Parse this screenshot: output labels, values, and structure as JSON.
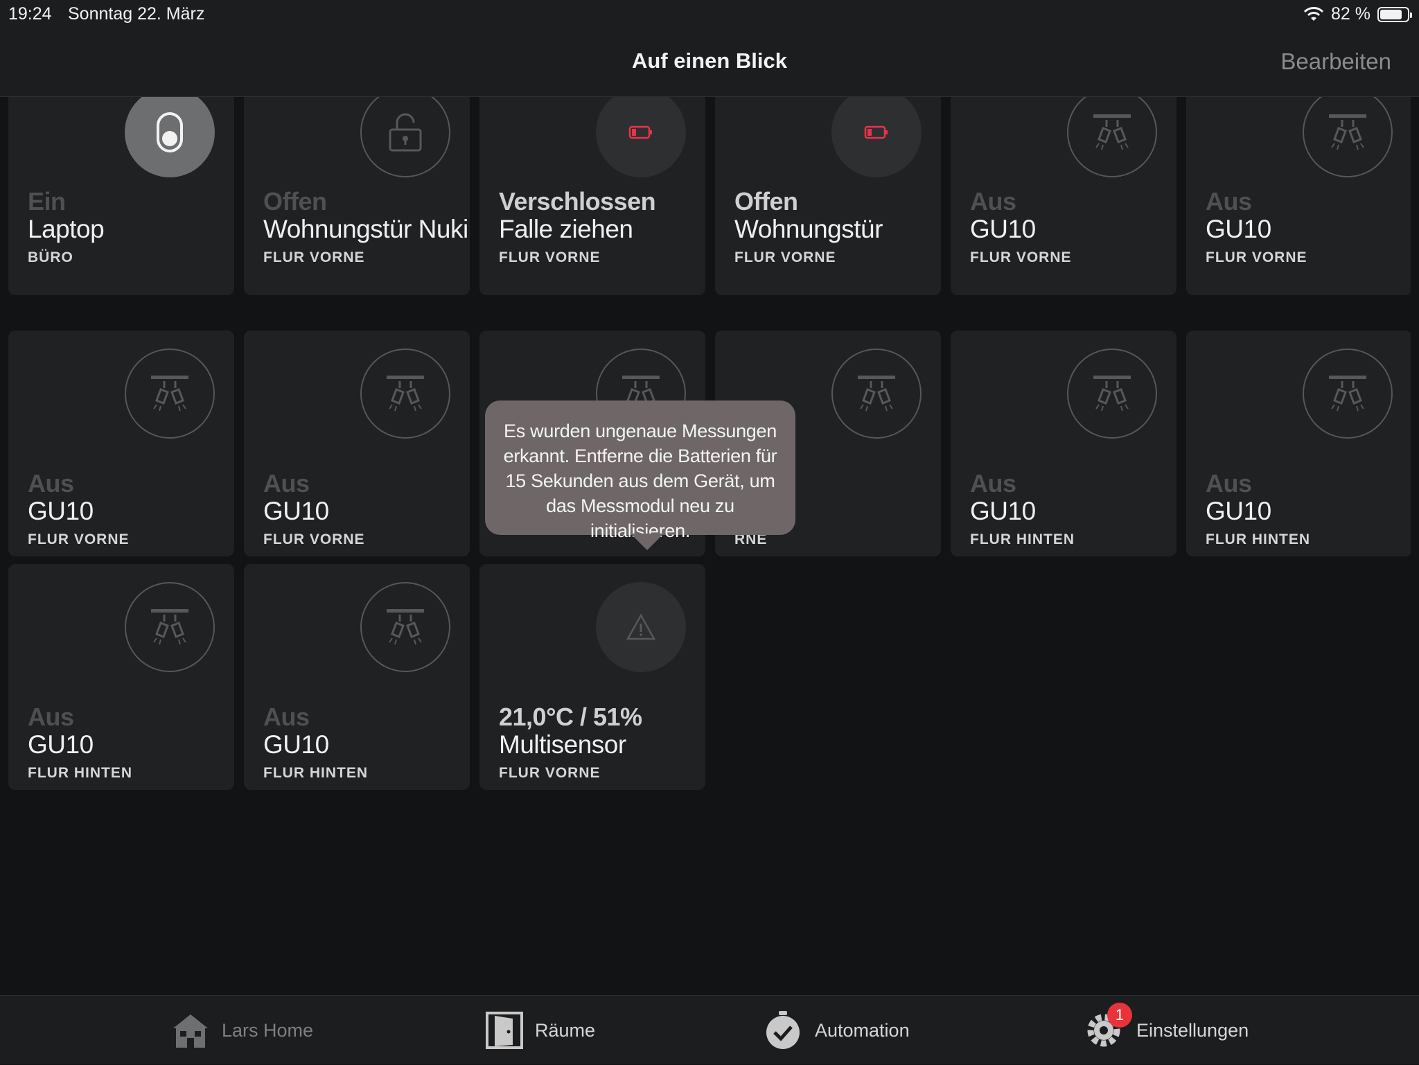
{
  "status_bar": {
    "time": "19:24",
    "date": "Sonntag 22. März",
    "battery_text": "82 %",
    "battery_level_percent": 82
  },
  "nav": {
    "title": "Auf einen Blick",
    "edit_label": "Bearbeiten"
  },
  "tiles": [
    {
      "state": "Ein",
      "name": "Laptop",
      "room": "BÜRO",
      "icon": "switch-icon",
      "state_active": false,
      "icon_style": "on"
    },
    {
      "state": "Offen",
      "name": "Wohnungstür Nuki",
      "room": "FLUR VORNE",
      "icon": "unlock-icon",
      "state_active": false,
      "icon_style": "outline"
    },
    {
      "state": "Verschlossen",
      "name": "Falle ziehen",
      "room": "FLUR VORNE",
      "icon": "low-battery-icon",
      "state_active": true,
      "icon_style": "filled"
    },
    {
      "state": "Offen",
      "name": "Wohnungstür",
      "room": "FLUR VORNE",
      "icon": "low-battery-icon",
      "state_active": true,
      "icon_style": "filled"
    },
    {
      "state": "Aus",
      "name": "GU10",
      "room": "FLUR VORNE",
      "icon": "spotlight-icon",
      "state_active": false,
      "icon_style": "outline"
    },
    {
      "state": "Aus",
      "name": "GU10",
      "room": "FLUR VORNE",
      "icon": "spotlight-icon",
      "state_active": false,
      "icon_style": "outline"
    },
    {
      "state": "Aus",
      "name": "GU10",
      "room": "FLUR VORNE",
      "icon": "spotlight-icon",
      "state_active": false,
      "icon_style": "outline"
    },
    {
      "state": "Aus",
      "name": "GU10",
      "room": "FLUR VORNE",
      "icon": "spotlight-icon",
      "state_active": false,
      "icon_style": "outline"
    },
    {
      "state": "",
      "name": "",
      "room": "",
      "icon": "spotlight-icon",
      "state_active": false,
      "icon_style": "outline"
    },
    {
      "state": "",
      "name": "",
      "room": "RNE",
      "icon": "spotlight-icon",
      "state_active": false,
      "icon_style": "outline"
    },
    {
      "state": "Aus",
      "name": "GU10",
      "room": "FLUR HINTEN",
      "icon": "spotlight-icon",
      "state_active": false,
      "icon_style": "outline"
    },
    {
      "state": "Aus",
      "name": "GU10",
      "room": "FLUR HINTEN",
      "icon": "spotlight-icon",
      "state_active": false,
      "icon_style": "outline"
    },
    {
      "state": "Aus",
      "name": "GU10",
      "room": "FLUR HINTEN",
      "icon": "spotlight-icon",
      "state_active": false,
      "icon_style": "outline"
    },
    {
      "state": "Aus",
      "name": "GU10",
      "room": "FLUR HINTEN",
      "icon": "spotlight-icon",
      "state_active": false,
      "icon_style": "outline"
    },
    {
      "state": "21,0°C / 51%",
      "name": "Multisensor",
      "room": "FLUR VORNE",
      "icon": "warning-icon",
      "state_active": true,
      "icon_style": "filled"
    }
  ],
  "tooltip": {
    "text": "Es wurden ungenaue Messungen erkannt. Entferne die Batterien für 15 Sekunden aus dem Gerät, um das Messmodul neu zu initialisieren."
  },
  "tab_bar": {
    "tabs": [
      {
        "label": "Lars Home",
        "icon": "home-icon",
        "selected": false
      },
      {
        "label": "Räume",
        "icon": "door-icon",
        "selected": true
      },
      {
        "label": "Automation",
        "icon": "timer-icon",
        "selected": true
      },
      {
        "label": "Einstellungen",
        "icon": "gear-icon",
        "selected": true,
        "badge": "1"
      }
    ]
  }
}
